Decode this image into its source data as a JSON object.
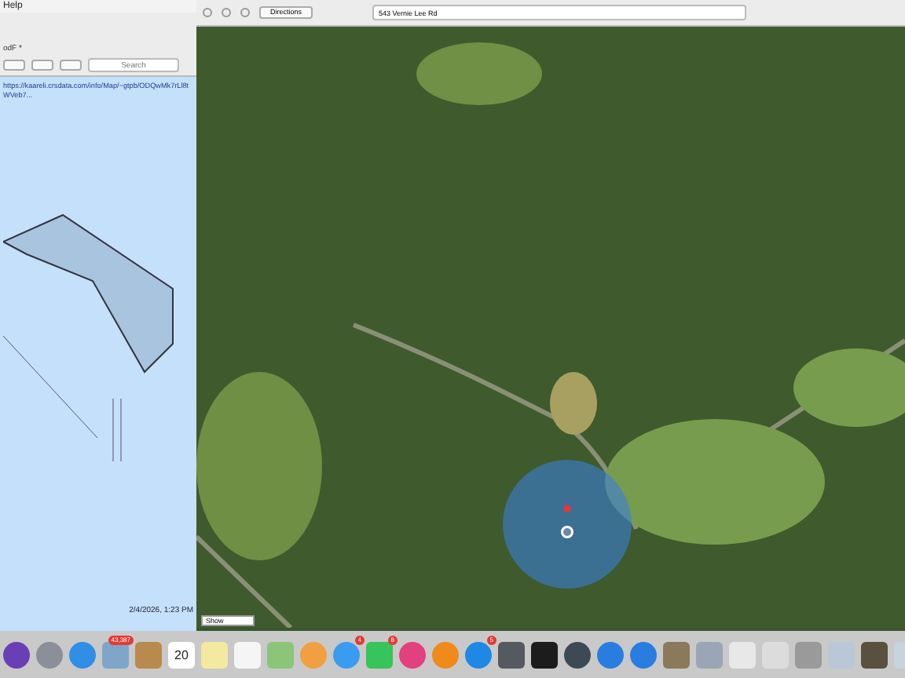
{
  "menu_bar": {
    "items": [
      "Help"
    ]
  },
  "preview_window": {
    "title": "odF *",
    "search": {
      "placeholder": "Search"
    },
    "url": "https://kaareli.crsdata.com/info/Map/~gtpb/ODQwMk7rLl8tWVeb7...",
    "timestamp": "2/4/2026, 1:23 PM"
  },
  "maps_window": {
    "directions_button": "Directions",
    "address": "543 Vernie Lee Rd",
    "show_menu": "Show"
  },
  "dock": {
    "items": [
      {
        "kind": "round",
        "color": "#6a3fb5"
      },
      {
        "kind": "round",
        "color": "#8a8f99"
      },
      {
        "kind": "round",
        "color": "#2f8fe6"
      },
      {
        "kind": "square",
        "color": "#7fa6c9",
        "badge": "43,387"
      },
      {
        "kind": "square",
        "color": "#b88a4d"
      },
      {
        "kind": "calendar",
        "color": "#ffffff",
        "label": "20"
      },
      {
        "kind": "square",
        "color": "#f4e9a0"
      },
      {
        "kind": "square",
        "color": "#f5f5f5"
      },
      {
        "kind": "square",
        "color": "#8cc47a"
      },
      {
        "kind": "round",
        "color": "#f0a040"
      },
      {
        "kind": "round",
        "color": "#3a9cf0",
        "badge": "4"
      },
      {
        "kind": "square",
        "color": "#37c45a",
        "badge": "8"
      },
      {
        "kind": "round",
        "color": "#e2407e"
      },
      {
        "kind": "round",
        "color": "#f08a1a"
      },
      {
        "kind": "round",
        "color": "#1e88e5",
        "badge": "5"
      },
      {
        "kind": "square",
        "color": "#555a60"
      },
      {
        "kind": "square",
        "color": "#1c1c1c"
      },
      {
        "kind": "round",
        "color": "#3d4a55"
      },
      {
        "kind": "round",
        "color": "#2a7de0"
      },
      {
        "kind": "round",
        "color": "#2a7de0"
      },
      {
        "kind": "square",
        "color": "#8a7a5a"
      },
      {
        "kind": "square",
        "color": "#9aa6b5"
      },
      {
        "kind": "square",
        "color": "#e8e8e8"
      },
      {
        "kind": "square",
        "color": "#dcdcdc"
      },
      {
        "kind": "square",
        "color": "#9a9a9a"
      },
      {
        "kind": "square",
        "color": "#b9c7d6"
      },
      {
        "kind": "square",
        "color": "#5a5040"
      },
      {
        "kind": "square",
        "color": "#c7d3de"
      }
    ]
  }
}
